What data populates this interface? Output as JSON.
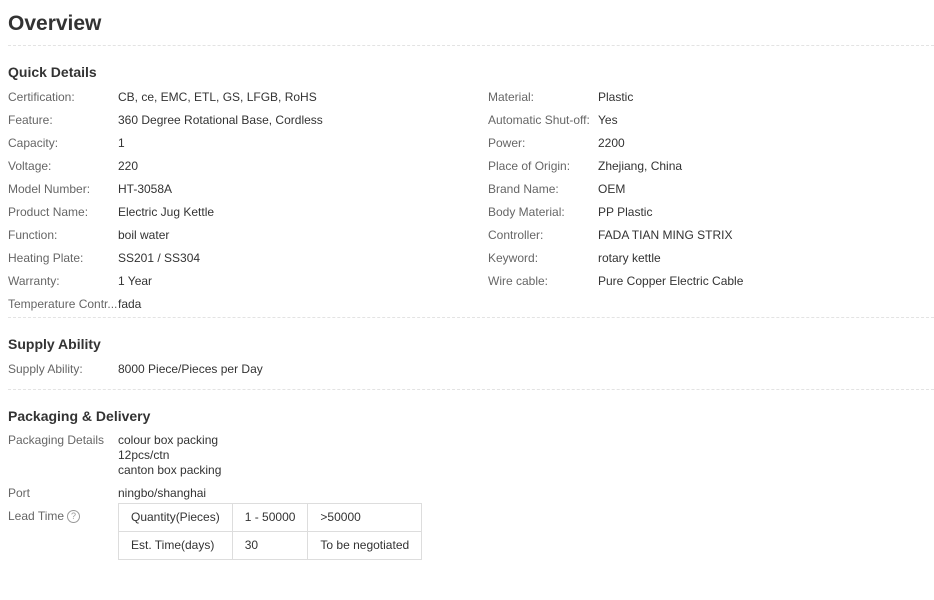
{
  "overview_title": "Overview",
  "quick_details": {
    "title": "Quick Details",
    "left": [
      {
        "label": "Certification:",
        "value": "CB, ce, EMC, ETL, GS, LFGB, RoHS"
      },
      {
        "label": "Feature:",
        "value": "360 Degree Rotational Base, Cordless"
      },
      {
        "label": "Capacity:",
        "value": "1"
      },
      {
        "label": "Voltage:",
        "value": "220"
      },
      {
        "label": "Model Number:",
        "value": "HT-3058A"
      },
      {
        "label": "Product Name:",
        "value": "Electric Jug Kettle"
      },
      {
        "label": "Function:",
        "value": "boil water"
      },
      {
        "label": "Heating Plate:",
        "value": "SS201 / SS304"
      },
      {
        "label": "Warranty:",
        "value": "1 Year"
      },
      {
        "label": "Temperature Contr...",
        "value": "fada"
      }
    ],
    "right": [
      {
        "label": "Material:",
        "value": "Plastic"
      },
      {
        "label": "Automatic Shut-off:",
        "value": "Yes"
      },
      {
        "label": "Power:",
        "value": "2200"
      },
      {
        "label": "Place of Origin:",
        "value": "Zhejiang, China"
      },
      {
        "label": "Brand Name:",
        "value": "OEM"
      },
      {
        "label": "Body Material:",
        "value": "PP Plastic"
      },
      {
        "label": "Controller:",
        "value": "FADA TIAN MING STRIX"
      },
      {
        "label": "Keyword:",
        "value": "rotary kettle"
      },
      {
        "label": "Wire cable:",
        "value": "Pure Copper Electric Cable"
      }
    ]
  },
  "supply_ability": {
    "title": "Supply Ability",
    "label": "Supply Ability:",
    "value": "8000 Piece/Pieces per Day"
  },
  "packaging": {
    "title": "Packaging & Delivery",
    "details_label": "Packaging Details",
    "details_lines": [
      "colour box packing",
      "12pcs/ctn",
      "canton box packing"
    ],
    "port_label": "Port",
    "port_value": "ningbo/shanghai",
    "lead_time_label": "Lead Time",
    "help_icon_glyph": "?",
    "lead_table": [
      [
        "Quantity(Pieces)",
        "1 - 50000",
        ">50000"
      ],
      [
        "Est. Time(days)",
        "30",
        "To be negotiated"
      ]
    ]
  }
}
